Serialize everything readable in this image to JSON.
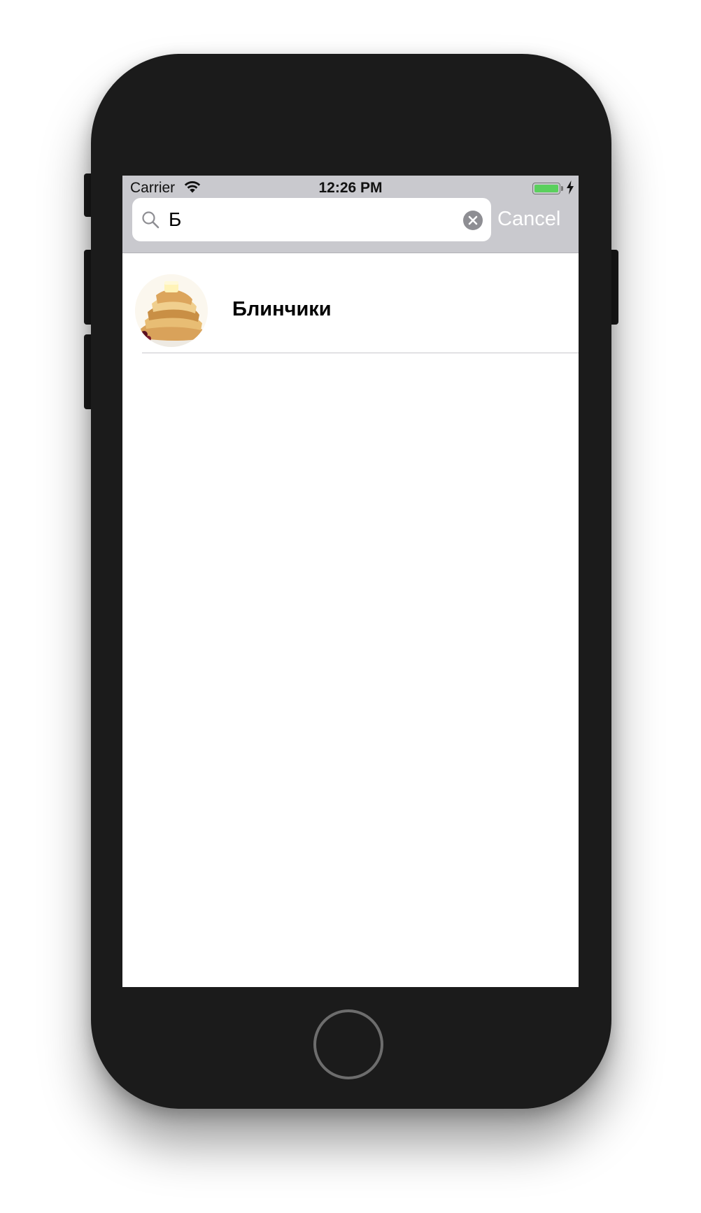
{
  "status_bar": {
    "carrier": "Carrier",
    "time": "12:26 PM"
  },
  "search": {
    "query": "Б",
    "cancel_label": "Cancel"
  },
  "results": [
    {
      "title": "Блинчики",
      "thumbnail_icon": "pancakes-photo"
    }
  ],
  "colors": {
    "search_bar_bg": "#c9c9ce",
    "battery_green": "#5ad05d",
    "device_body": "#1b1b1b"
  }
}
